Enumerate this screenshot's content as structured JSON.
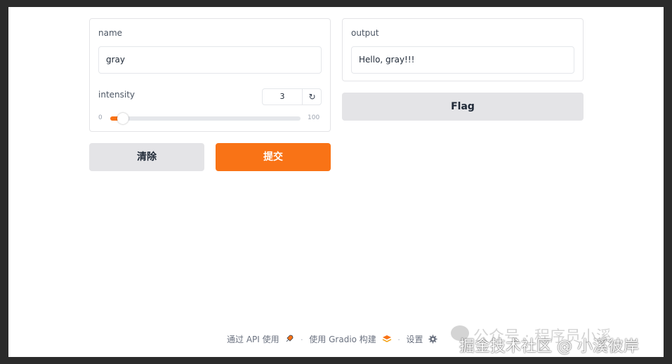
{
  "inputs": {
    "name": {
      "label": "name",
      "value": "gray"
    },
    "intensity": {
      "label": "intensity",
      "value": "3",
      "min": "0",
      "max": "100",
      "reset_icon": "↻",
      "fraction": 0.03
    }
  },
  "buttons": {
    "clear": "清除",
    "submit": "提交",
    "flag": "Flag"
  },
  "output": {
    "label": "output",
    "value": "Hello, gray!!!"
  },
  "footer": {
    "api": "通过 API 使用",
    "api_icon": "rocket-icon",
    "sep": "·",
    "built": "使用 Gradio 构建",
    "built_icon": "gradio-logo-icon",
    "settings": "设置",
    "settings_icon": "gear-icon"
  },
  "watermark": {
    "faint": "公众号 · 程序员小溪",
    "main": "掘金技术社区 @ 小溪彼岸"
  },
  "colors": {
    "primary": "#f97316",
    "secondary": "#e4e4e7",
    "border": "#e4e4e7"
  }
}
